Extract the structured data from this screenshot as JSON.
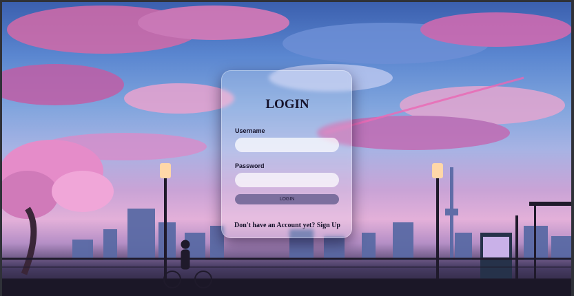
{
  "login": {
    "title": "LOGIN",
    "username_label": "Username",
    "username_value": "",
    "password_label": "Password",
    "password_value": "",
    "button_label": "LOGIN",
    "signup_prompt": "Don't have an Account yet?",
    "signup_link": "Sign Up"
  },
  "colors": {
    "button": "#7c6f9e",
    "text": "#15122a",
    "card": "rgba(255,255,255,0.18)"
  }
}
